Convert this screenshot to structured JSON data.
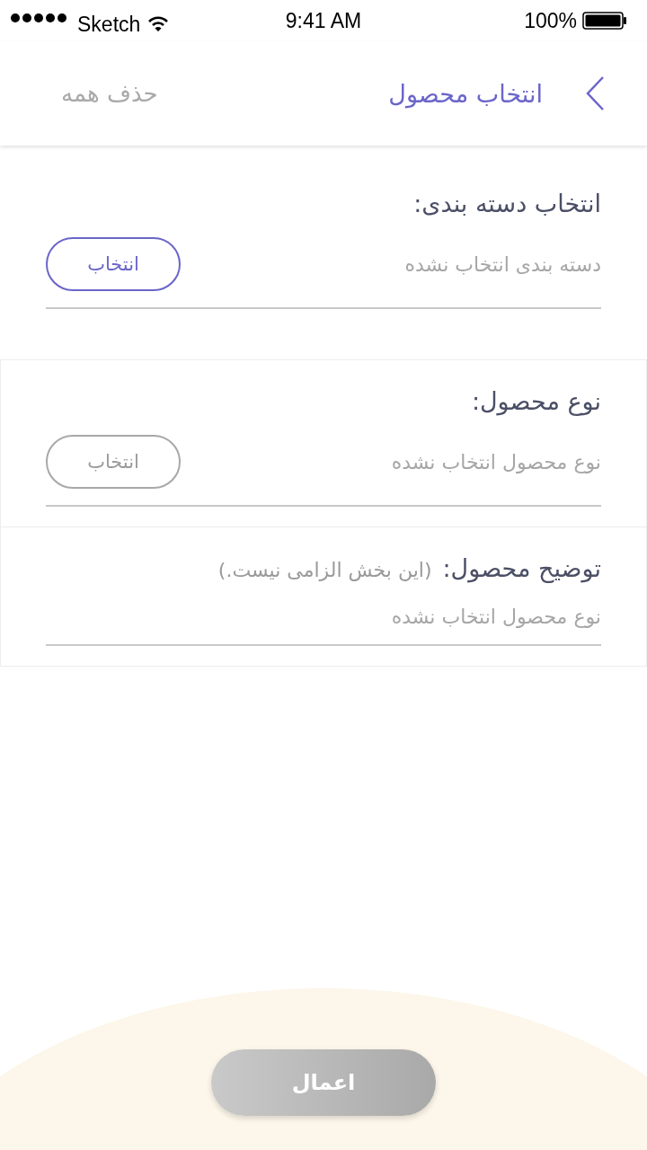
{
  "status_bar": {
    "carrier": "Sketch",
    "time": "9:41 AM",
    "battery": "100%"
  },
  "header": {
    "title": "انتخاب محصول",
    "action": "حذف همه"
  },
  "category": {
    "label": "انتخاب دسته بندی:",
    "value": "دسته بندی انتخاب نشده",
    "button": {
      "label": "انتخاب",
      "disabled": false
    }
  },
  "cards": [
    {
      "kind": "picker",
      "label": "نوع محصول:",
      "value": "نوع محصول انتخاب نشده",
      "button": {
        "label": "انتخاب",
        "disabled": true
      }
    },
    {
      "kind": "text",
      "label": "توضیح محصول:",
      "note": "(این بخش الزامی نیست.)",
      "placeholder": "نوع محصول انتخاب نشده"
    }
  ],
  "apply_button": {
    "label": "اعمال",
    "disabled": true
  }
}
